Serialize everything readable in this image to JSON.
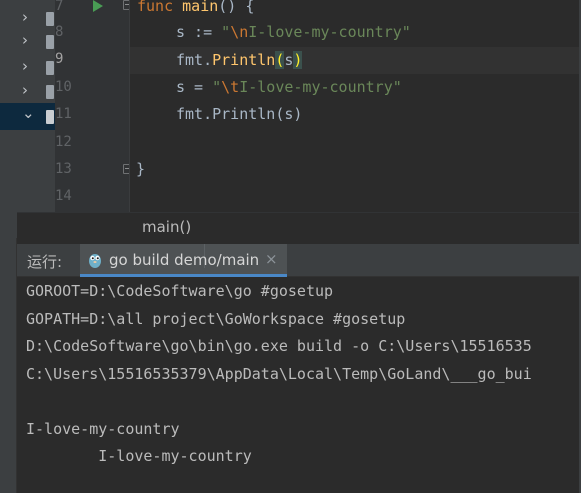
{
  "editor": {
    "line_numbers": [
      "7",
      "8",
      "9",
      "10",
      "11",
      "12",
      "13",
      "14"
    ],
    "lines": {
      "l7_kw": "func",
      "l7_name": "main",
      "l7_rest": "() {",
      "l8_lhs": "s := ",
      "l8_q1": "\"",
      "l8_esc": "\\n",
      "l8_str": "I-love-my-country\"",
      "l9_pkg": "fmt.",
      "l9_call": "Println",
      "l9_open": "(",
      "l9_arg": "s",
      "l9_close": ")",
      "l10_lhs": "s = ",
      "l10_q1": "\"",
      "l10_esc": "\\t",
      "l10_str": "I-love-my-country\"",
      "l11": "fmt.Println(s)",
      "l13": "}"
    },
    "current_line": "9"
  },
  "breadcrumb": {
    "function": "main()"
  },
  "run_panel": {
    "label": "运行:",
    "tab_label": "go build demo/main",
    "tab_close": "×",
    "output": [
      "GOROOT=D:\\CodeSoftware\\go #gosetup",
      "GOPATH=D:\\all project\\GoWorkspace #gosetup",
      "D:\\CodeSoftware\\go\\bin\\go.exe build -o C:\\Users\\15516535",
      "C:\\Users\\15516535379\\AppData\\Local\\Temp\\GoLand\\___go_bui",
      "",
      "I-love-my-country",
      "        I-love-my-country"
    ]
  },
  "tree": {
    "icons": [
      "chevron-right-icon",
      "chevron-right-icon",
      "chevron-right-icon",
      "chevron-right-icon",
      "chevron-down-icon"
    ]
  },
  "colors": {
    "keyword": "#cc7832",
    "function": "#ffc66d",
    "string": "#6a8759",
    "run_icon": "#499c54",
    "tab_underline": "#4a88c7"
  }
}
